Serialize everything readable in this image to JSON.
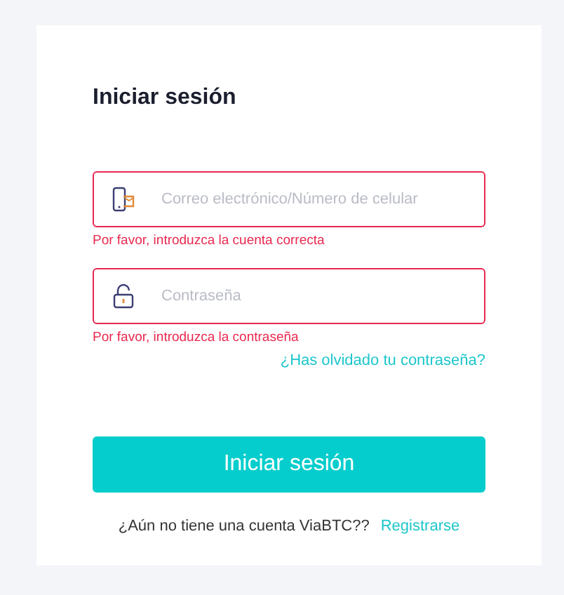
{
  "title": "Iniciar sesión",
  "fields": [
    {
      "kind": "account",
      "placeholder": "Correo electrónico/Número de celular",
      "invalid": true,
      "error": "Por favor, introduzca la cuenta correcta"
    },
    {
      "kind": "password",
      "placeholder": "Contraseña",
      "invalid": true,
      "error": "Por favor, introduzca la contraseña"
    }
  ],
  "forgot_link": "¿Has olvidado tu contraseña?",
  "submit_button": "Iniciar sesión",
  "footer": {
    "text": "¿Aún no tiene una cuenta ViaBTC??",
    "link": "Registrarse"
  }
}
